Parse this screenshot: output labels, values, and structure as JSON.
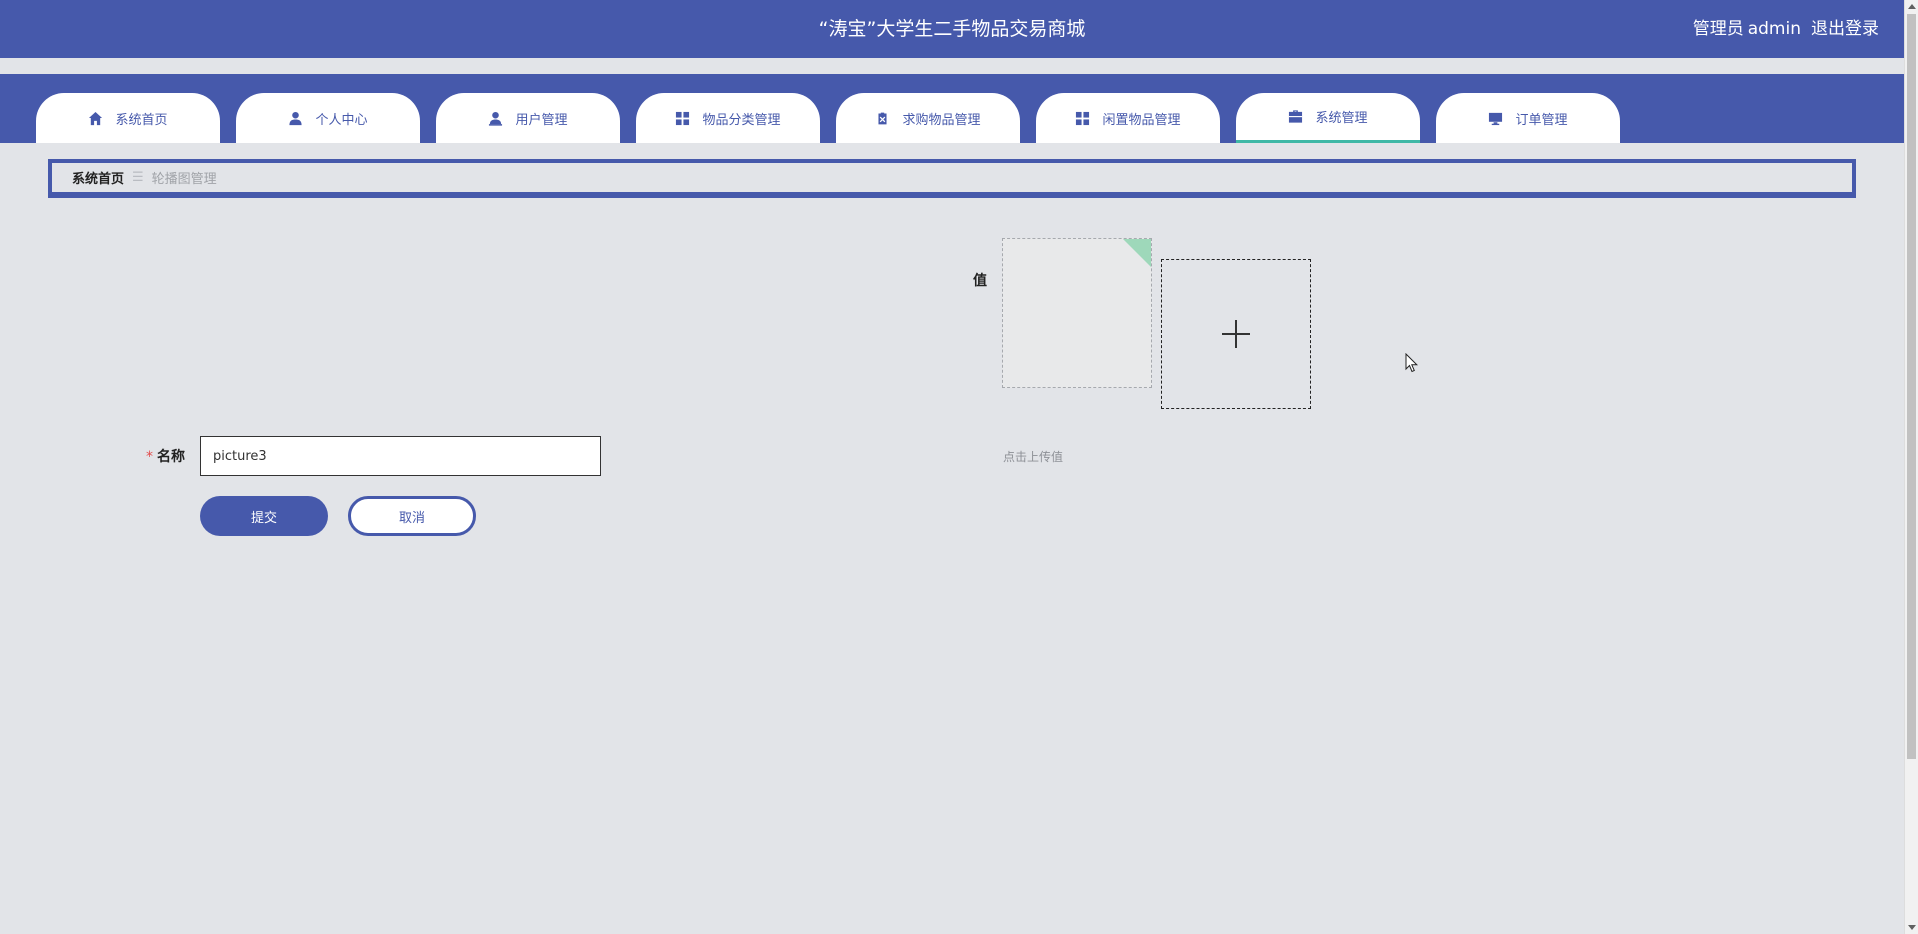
{
  "header": {
    "title": "“涛宝”大学生二手物品交易商城",
    "role": "管理员",
    "username": "admin",
    "logout": "退出登录"
  },
  "nav": {
    "tabs": [
      {
        "label": "系统首页",
        "icon": "home-icon"
      },
      {
        "label": "个人中心",
        "icon": "person-icon"
      },
      {
        "label": "用户管理",
        "icon": "user-badge-icon"
      },
      {
        "label": "物品分类管理",
        "icon": "grid-icon"
      },
      {
        "label": "求购物品管理",
        "icon": "clipboard-icon"
      },
      {
        "label": "闲置物品管理",
        "icon": "grid-icon"
      },
      {
        "label": "系统管理",
        "icon": "briefcase-icon",
        "active": true
      },
      {
        "label": "订单管理",
        "icon": "monitor-icon"
      }
    ]
  },
  "breadcrumb": {
    "home": "系统首页",
    "separator": "☰",
    "current": "轮播图管理"
  },
  "form": {
    "value_label": "值",
    "upload_tip": "点击上传值",
    "name_label": "名称",
    "required_mark": "*",
    "name_value": "picture3",
    "submit_label": "提交",
    "cancel_label": "取消"
  },
  "colors": {
    "primary": "#4659ab",
    "accent": "#3fb8a6",
    "background": "#e2e4e8",
    "required": "#e34b4b"
  }
}
